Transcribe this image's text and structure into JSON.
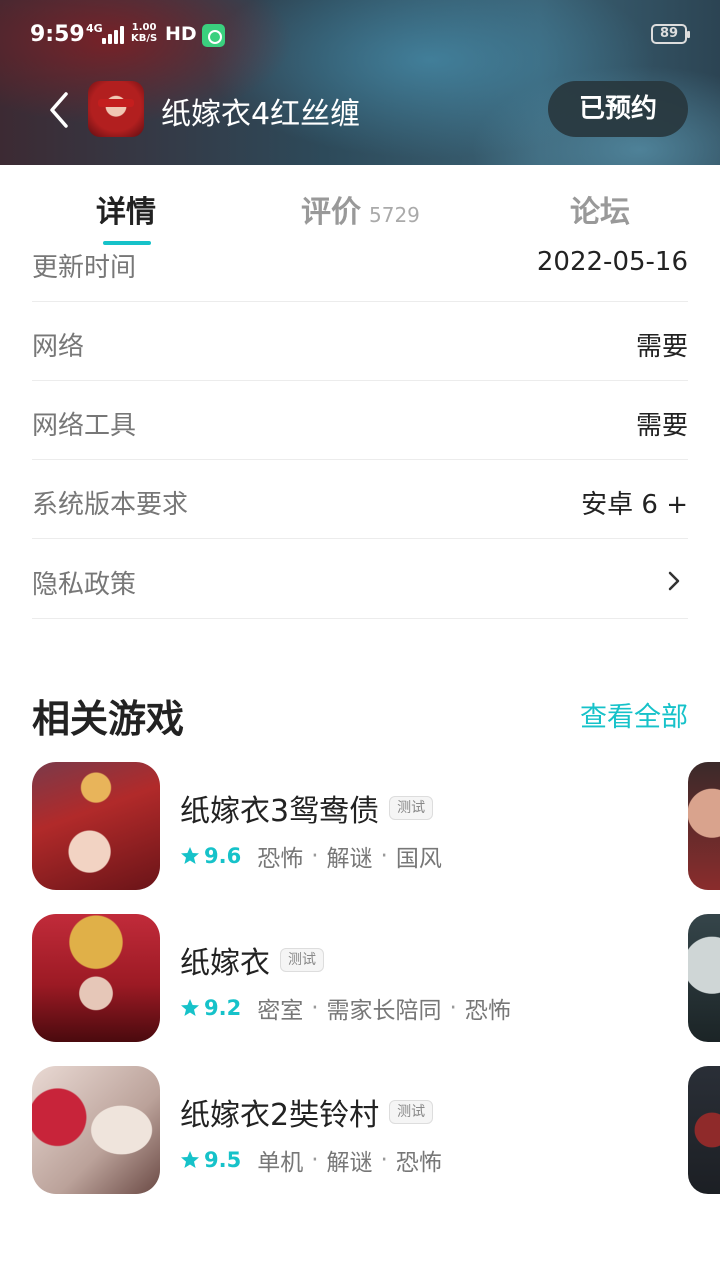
{
  "status_bar": {
    "time": "9:59",
    "network": "4G",
    "speed_value": "1.00",
    "speed_unit": "KB/S",
    "hd": "HD",
    "battery": "89"
  },
  "header": {
    "title": "纸嫁衣4红丝缠",
    "reserve_label": "已预约"
  },
  "tabs": [
    {
      "label": "详情",
      "active": true
    },
    {
      "label": "评价",
      "count": "5729",
      "active": false
    },
    {
      "label": "论坛",
      "active": false
    }
  ],
  "info": [
    {
      "label": "更新时间",
      "value": "2022-05-16"
    },
    {
      "label": "网络",
      "value": "需要"
    },
    {
      "label": "网络工具",
      "value": "需要"
    },
    {
      "label": "系统版本要求",
      "value": "安卓 6 +"
    },
    {
      "label": "隐私政策",
      "value": ""
    }
  ],
  "related": {
    "title": "相关游戏",
    "see_all": "查看全部",
    "games": [
      {
        "name": "纸嫁衣3鸳鸯债",
        "badge": "测试",
        "rating": "9.6",
        "tags": [
          "恐怖",
          "解谜",
          "国风"
        ]
      },
      {
        "name": "纸嫁衣",
        "badge": "测试",
        "rating": "9.2",
        "tags": [
          "密室",
          "需家长陪同",
          "恐怖"
        ]
      },
      {
        "name": "纸嫁衣2奘铃村",
        "badge": "测试",
        "rating": "9.5",
        "tags": [
          "单机",
          "解谜",
          "恐怖"
        ]
      }
    ]
  },
  "colors": {
    "accent": "#16c2c9",
    "text_primary": "#222222",
    "text_secondary": "#777777",
    "divider": "#ececec"
  }
}
